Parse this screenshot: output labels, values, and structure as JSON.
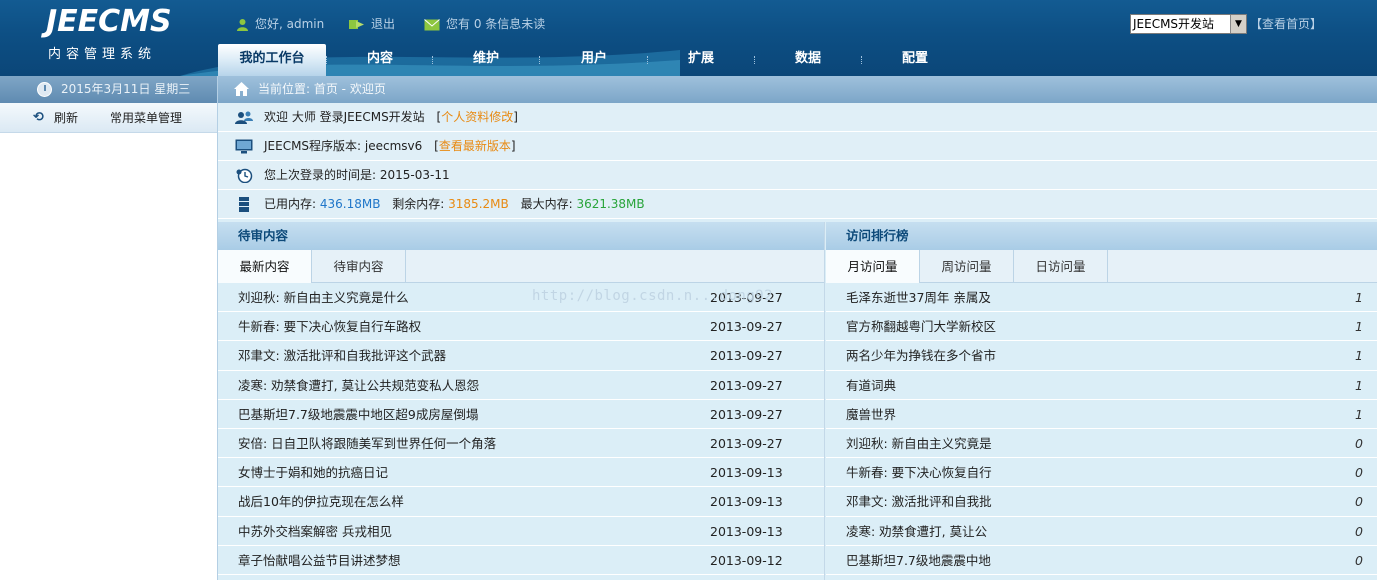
{
  "header": {
    "logo_main": "JEECMS",
    "logo_sub": "内容管理系统",
    "greeting": "您好, admin",
    "logout": "退出",
    "messages": "您有 0 条信息未读",
    "site_select": "JEECMS开发站",
    "view_home": "【查看首页】"
  },
  "nav": {
    "items": [
      {
        "label": "我的工作台"
      },
      {
        "label": "内容"
      },
      {
        "label": "维护"
      },
      {
        "label": "用户"
      },
      {
        "label": "扩展"
      },
      {
        "label": "数据"
      },
      {
        "label": "配置"
      }
    ]
  },
  "sidebar": {
    "date": "2015年3月11日 星期三",
    "refresh": "刷新",
    "menu_manage": "常用菜单管理"
  },
  "main": {
    "breadcrumb": "当前位置: 首页 - 欢迎页",
    "welcome_prefix": "欢迎 大师  登录JEECMS开发站",
    "profile_link": "个人资料修改",
    "version_label": "JEECMS程序版本: jeecmsv6",
    "version_link": "查看最新版本",
    "last_login": "您上次登录的时间是: 2015-03-11",
    "mem_used_label": "已用内存:",
    "mem_used": "436.18MB",
    "mem_free_label": "剩余内存:",
    "mem_free": "3185.2MB",
    "mem_max_label": "最大内存:",
    "mem_max": "3621.38MB"
  },
  "pending": {
    "title": "待审内容",
    "tabs": [
      "最新内容",
      "待审内容"
    ],
    "rows": [
      {
        "title": "刘迎秋: 新自由主义究竟是什么",
        "date": "2013-09-27"
      },
      {
        "title": "牛新春: 要下决心恢复自行车路权",
        "date": "2013-09-27"
      },
      {
        "title": "邓聿文: 激活批评和自我批评这个武器",
        "date": "2013-09-27"
      },
      {
        "title": "凌寒: 劝禁食遭打, 莫让公共规范变私人恩怨",
        "date": "2013-09-27"
      },
      {
        "title": "巴基斯坦7.7级地震震中地区超9成房屋倒塌",
        "date": "2013-09-27"
      },
      {
        "title": "安倍: 日自卫队将跟随美军到世界任何一个角落",
        "date": "2013-09-27"
      },
      {
        "title": "女博士于娟和她的抗癌日记",
        "date": "2013-09-13"
      },
      {
        "title": "战后10年的伊拉克现在怎么样",
        "date": "2013-09-13"
      },
      {
        "title": "中苏外交档案解密 兵戎相见",
        "date": "2013-09-13"
      },
      {
        "title": "章子怡献唱公益节目讲述梦想",
        "date": "2013-09-12"
      }
    ]
  },
  "ranking": {
    "title": "访问排行榜",
    "tabs": [
      "月访问量",
      "周访问量",
      "日访问量"
    ],
    "rows": [
      {
        "title": "毛泽东逝世37周年 亲属及",
        "count": "1"
      },
      {
        "title": "官方称翻越粤门大学新校区",
        "count": "1"
      },
      {
        "title": "两名少年为挣钱在多个省市",
        "count": "1"
      },
      {
        "title": "有道词典",
        "count": "1"
      },
      {
        "title": "魔兽世界",
        "count": "1"
      },
      {
        "title": "刘迎秋: 新自由主义究竟是",
        "count": "0"
      },
      {
        "title": "牛新春: 要下决心恢复自行",
        "count": "0"
      },
      {
        "title": "邓聿文: 激活批评和自我批",
        "count": "0"
      },
      {
        "title": "凌寒: 劝禁食遭打, 莫让公",
        "count": "0"
      },
      {
        "title": "巴基斯坦7.7级地震震中地",
        "count": "0"
      }
    ]
  },
  "watermark": "http://blog.csdn.n...dong92",
  "colors": {
    "header": "#0d4f84",
    "main_bg": "#dbeef7",
    "accent_orange": "#e88a12",
    "accent_blue": "#1f76c9",
    "accent_green": "#28a43a"
  }
}
